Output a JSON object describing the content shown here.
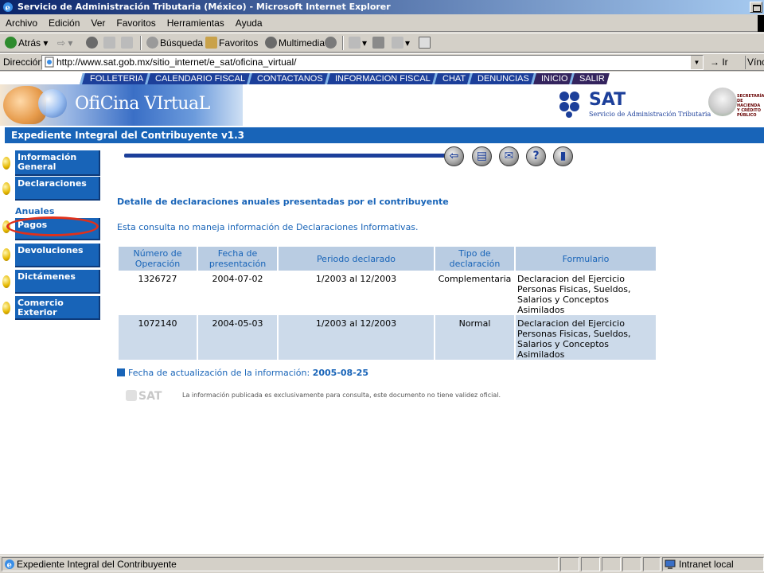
{
  "window": {
    "title": "Servicio de Administración Tributaria (México) - Microsoft Internet Explorer"
  },
  "menu": [
    "Archivo",
    "Edición",
    "Ver",
    "Favoritos",
    "Herramientas",
    "Ayuda"
  ],
  "toolbar": {
    "back": "Atrás",
    "search": "Búsqueda",
    "favorites": "Favoritos",
    "multimedia": "Multimedia"
  },
  "address": {
    "label": "Dirección",
    "url": "http://www.sat.gob.mx/sitio_internet/e_sat/oficina_virtual/",
    "go": "Ir",
    "links": "Vínculos"
  },
  "topnav": [
    "FOLLETERIA",
    "CALENDARIO FISCAL",
    "CONTACTANOS",
    "INFORMACION FISCAL",
    "CHAT",
    "DENUNCIAS",
    "INICIO",
    "SALIR"
  ],
  "banner": {
    "brand": "OfiCina VIrtuaL",
    "sat": "SAT",
    "sat_sub": "Servicio de Administración Tributaria",
    "shhcp": "SECRETARÍA DE HACIENDA Y CRÉDITO PÚBLICO"
  },
  "app_title": "Expediente Integral del Contribuyente v1.3",
  "sidebar": {
    "items": [
      "Información General",
      "Declaraciones",
      "Pagos",
      "Devoluciones",
      "Dictámenes",
      "Comercio Exterior"
    ],
    "section_label": "Anuales"
  },
  "icons": [
    "back-icon",
    "print-icon",
    "mail-icon",
    "help-icon",
    "exit-icon"
  ],
  "content": {
    "title": "Detalle de declaraciones anuales presentadas por el contribuyente",
    "note": "Esta consulta no maneja información de Declaraciones Informativas.",
    "table": {
      "headers": [
        "Número de Operación",
        "Fecha de presentación",
        "Periodo declarado",
        "Tipo de declaración",
        "Formulario"
      ],
      "rows": [
        [
          "1326727",
          "2004-07-02",
          "1/2003 al 12/2003",
          "Complementaria",
          "Declaracion del Ejercicio Personas Fisicas, Sueldos, Salarios y Conceptos Asimilados"
        ],
        [
          "1072140",
          "2004-05-03",
          "1/2003 al 12/2003",
          "Normal",
          "Declaracion del Ejercicio Personas Fisicas, Sueldos, Salarios y Conceptos Asimilados"
        ]
      ]
    },
    "update_label": "Fecha de actualización de la información:",
    "update_date": "2005-08-25",
    "footer_logo": "SAT",
    "disclaimer": "La información publicada es exclusivamente para consulta, este documento no tiene validez oficial."
  },
  "status": {
    "text": "Expediente Integral del Contribuyente",
    "zone": "Intranet local"
  },
  "colors": {
    "header_blue": "#1864b8",
    "nav_blue": "#1c3f9a",
    "table_header": "#b9cce2",
    "highlight_circle": "#e0301a"
  }
}
